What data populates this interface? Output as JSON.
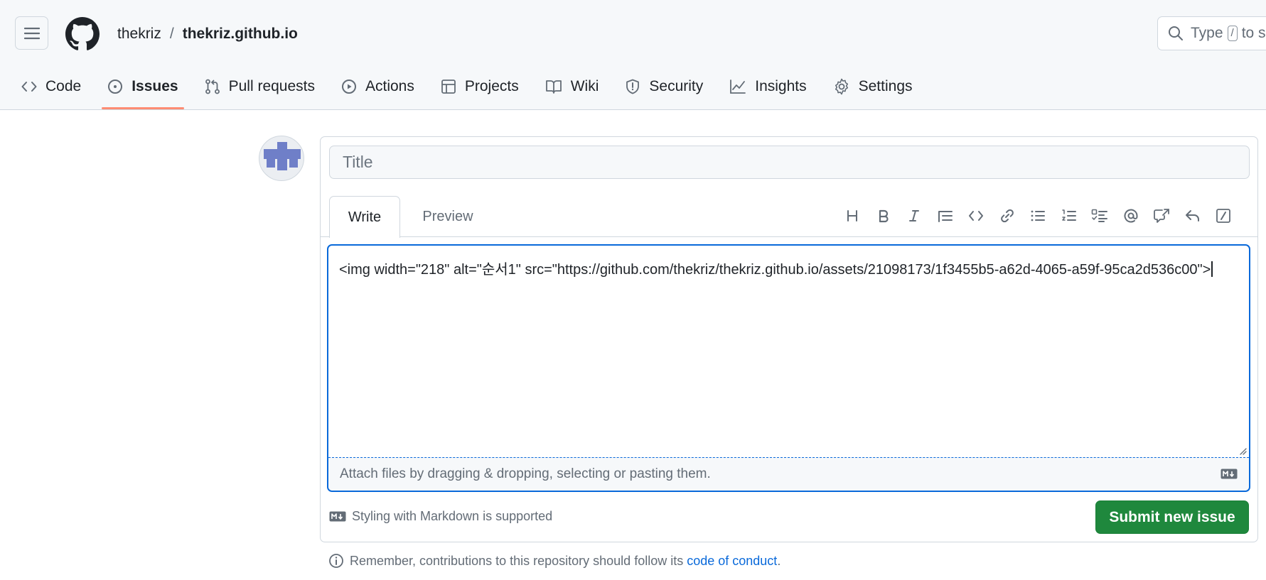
{
  "header": {
    "owner": "thekriz",
    "separator": "/",
    "repo": "thekriz.github.io",
    "search_text_before": "Type",
    "search_kbd": "/",
    "search_text_after": "to s"
  },
  "nav": {
    "tabs": [
      {
        "label": "Code",
        "icon": "code-icon"
      },
      {
        "label": "Issues",
        "icon": "issue-opened-icon",
        "active": true
      },
      {
        "label": "Pull requests",
        "icon": "git-pull-request-icon"
      },
      {
        "label": "Actions",
        "icon": "play-icon"
      },
      {
        "label": "Projects",
        "icon": "table-icon"
      },
      {
        "label": "Wiki",
        "icon": "book-icon"
      },
      {
        "label": "Security",
        "icon": "shield-icon"
      },
      {
        "label": "Insights",
        "icon": "graph-icon"
      },
      {
        "label": "Settings",
        "icon": "gear-icon"
      }
    ]
  },
  "form": {
    "title_placeholder": "Title",
    "write_tab": "Write",
    "preview_tab": "Preview",
    "toolbar": [
      "heading-icon",
      "bold-icon",
      "italic-icon",
      "quote-icon",
      "code-icon",
      "link-icon",
      "unordered-list-icon",
      "ordered-list-icon",
      "task-list-icon",
      "mention-icon",
      "cross-reference-icon",
      "reply-icon",
      "slash-command-icon"
    ],
    "body_text": "<img width=\"218\" alt=\"순서1\" src=\"https://github.com/thekriz/thekriz.github.io/assets/21098173/1f3455b5-a62d-4065-a59f-95ca2d536c00\">",
    "attach_text": "Attach files by dragging & dropping, selecting or pasting them.",
    "styling_text": "Styling with Markdown is supported",
    "submit_label": "Submit new issue"
  },
  "footer": {
    "remember_text": "Remember, contributions to this repository should follow its",
    "remember_link": "code of conduct",
    "remember_end": "."
  },
  "colors": {
    "accent": "#0969da",
    "submit": "#1f883d",
    "active_underline": "#fd8c73"
  }
}
